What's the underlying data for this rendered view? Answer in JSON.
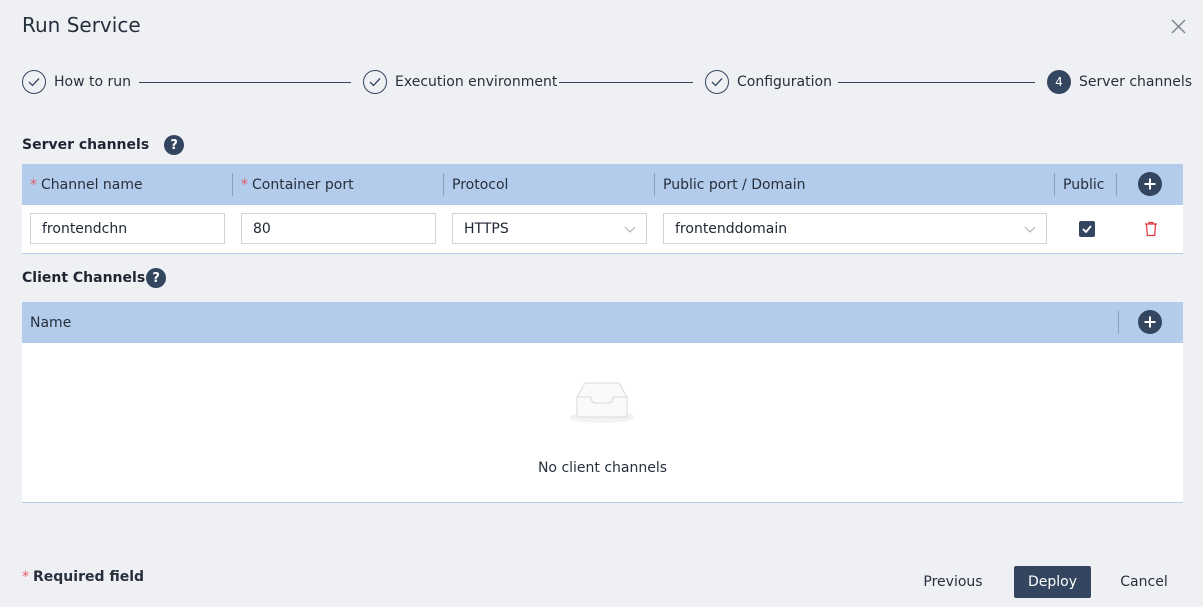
{
  "dialog": {
    "title": "Run Service",
    "close_icon": "close-icon"
  },
  "stepper": {
    "steps": [
      {
        "label": "How to run",
        "status": "completed",
        "icon": "check-icon"
      },
      {
        "label": "Execution environment",
        "status": "completed",
        "icon": "check-icon"
      },
      {
        "label": "Configuration",
        "status": "completed",
        "icon": "check-icon"
      },
      {
        "label": "Server channels",
        "status": "active",
        "number": "4"
      }
    ]
  },
  "server_channels": {
    "title": "Server channels",
    "help_icon": "?",
    "columns": [
      {
        "label": "Channel name",
        "required": true
      },
      {
        "label": "Container port",
        "required": true
      },
      {
        "label": "Protocol",
        "required": false
      },
      {
        "label": "Public port / Domain",
        "required": false
      },
      {
        "label": "Public",
        "required": false
      }
    ],
    "required_marker": "*",
    "rows": [
      {
        "channel_name": "frontendchn",
        "container_port": "80",
        "protocol": "HTTPS",
        "public_port_domain": "frontenddomain",
        "public": true
      }
    ]
  },
  "client_channels": {
    "title": "Client Channels",
    "help_icon": "?",
    "columns": [
      {
        "label": "Name"
      }
    ],
    "empty_text": "No client channels"
  },
  "footer": {
    "required_marker": "*",
    "required_text": "Required field",
    "previous_label": "Previous",
    "deploy_label": "Deploy",
    "cancel_label": "Cancel"
  },
  "colors": {
    "primary": "#34465f",
    "header_bg": "#b4cceb",
    "required": "#e45a63",
    "danger": "#e0313c",
    "page_bg": "#eff0f4"
  }
}
